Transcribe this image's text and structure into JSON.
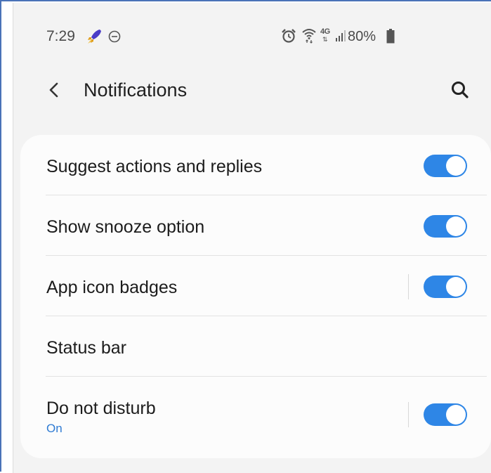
{
  "status_bar": {
    "time": "7:29",
    "battery": "80%",
    "network": "4G",
    "icons": [
      "rocket-icon",
      "dnd-status-icon",
      "alarm-icon",
      "wifi-icon",
      "signal-icon",
      "battery-icon"
    ]
  },
  "app_bar": {
    "title": "Notifications",
    "back_icon": "chevron-left-icon",
    "search_icon": "search-icon"
  },
  "settings": {
    "items": [
      {
        "label": "Suggest actions and replies",
        "toggle": true,
        "on": true
      },
      {
        "label": "Show snooze option",
        "toggle": true,
        "on": true
      },
      {
        "label": "App icon badges",
        "toggle": true,
        "on": true,
        "separator": true
      },
      {
        "label": "Status bar",
        "toggle": false
      },
      {
        "label": "Do not disturb",
        "sublabel": "On",
        "toggle": true,
        "on": true,
        "separator": true
      }
    ]
  },
  "colors": {
    "accent": "#2e86e6",
    "background": "#f3f3f3",
    "card": "#fcfcfc",
    "frame_border": "#4a72b8"
  }
}
